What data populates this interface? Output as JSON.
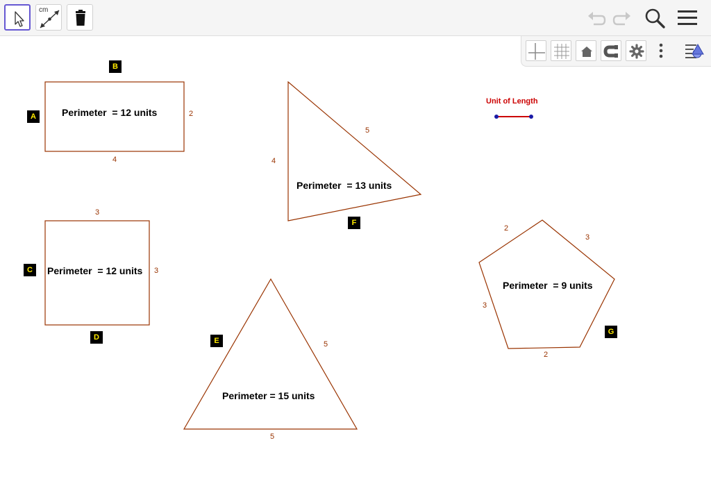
{
  "toolbar": {
    "measure_tool_text": "cm",
    "colors": {
      "selected_border": "#6557d2",
      "icon": "#333333",
      "undo_disabled": "#c8c8c8"
    }
  },
  "shapes": {
    "rectangle": {
      "label_left": "A",
      "label_top": "B",
      "top_side": "",
      "right_side": "2",
      "bottom_side": "4",
      "perimeter": "Perimeter  = 12 units"
    },
    "square": {
      "label_left": "C",
      "label_bottom": "D",
      "top_side": "3",
      "right_side": "3",
      "perimeter": "Perimeter  = 12 units"
    },
    "right_triangle": {
      "label": "F",
      "hypotenuse": "5",
      "vertical_side": "4",
      "perimeter": "Perimeter  = 13 units"
    },
    "triangle": {
      "label": "E",
      "right_side": "5",
      "bottom_side": "5",
      "perimeter": "Perimeter = 15 units"
    },
    "pentagon": {
      "label": "G",
      "upper_left_side": "2",
      "upper_right_side": "3",
      "left_side": "3",
      "bottom_side": "2",
      "perimeter": "Perimeter  = 9 units"
    }
  },
  "unit_of_length": {
    "title": "Unit of Length"
  },
  "colors": {
    "shape_stroke": "#993300",
    "label_bg": "#000000",
    "label_text": "#ffea00",
    "unit_segment": "#cc0000",
    "unit_points": "#1a1aa6"
  }
}
